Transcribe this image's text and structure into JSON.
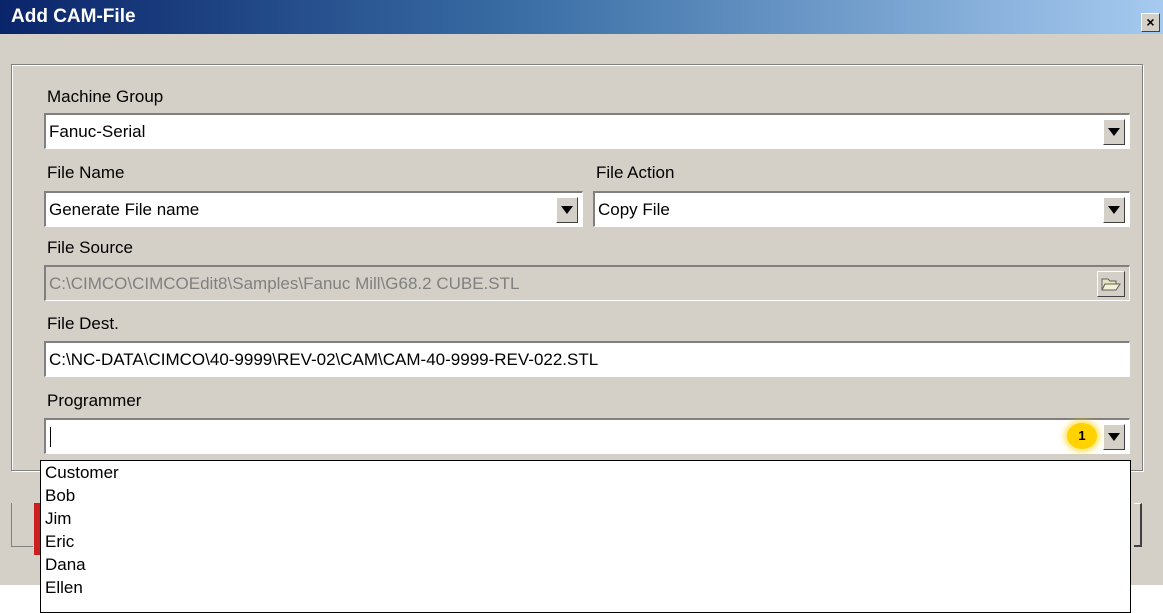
{
  "window": {
    "title": "Add CAM-File",
    "close_label": "×"
  },
  "form": {
    "machine_group": {
      "label": "Machine Group",
      "value": "Fanuc-Serial"
    },
    "file_name": {
      "label": "File Name",
      "value": "Generate File name"
    },
    "file_action": {
      "label": "File Action",
      "value": "Copy File"
    },
    "file_source": {
      "label": "File Source",
      "value": "C:\\CIMCO\\CIMCOEdit8\\Samples\\Fanuc Mill\\G68.2 CUBE.STL"
    },
    "file_dest": {
      "label": "File Dest.",
      "value": "C:\\NC-DATA\\CIMCO\\40-9999\\REV-02\\CAM\\CAM-40-9999-REV-022.STL"
    },
    "programmer": {
      "label": "Programmer",
      "value": "",
      "options": [
        "Customer",
        "Bob",
        "Jim",
        "Eric",
        "Dana",
        "Ellen"
      ]
    }
  },
  "annotation": {
    "badge": "1"
  },
  "icons": {
    "browse": "folder-open-icon",
    "dropdown": "chevron-down-icon"
  }
}
